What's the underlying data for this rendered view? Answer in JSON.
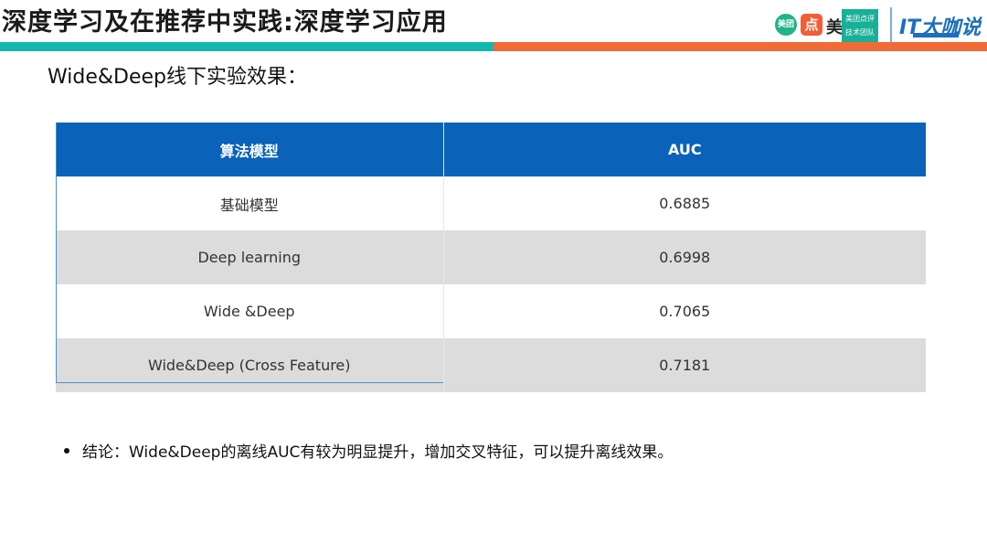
{
  "header": {
    "title": "深度学习及在推荐中实践:深度学习应用",
    "logos": {
      "meituan": "美团",
      "dianping_glyph": "点",
      "mei": "美",
      "team_line1": "美团点评",
      "team_line2": "技术团队",
      "it": "IT大咖说"
    }
  },
  "subtitle": "Wide&Deep线下实验效果：",
  "table": {
    "headers": [
      "算法模型",
      "AUC"
    ],
    "rows": [
      {
        "model": "基础模型",
        "auc": "0.6885"
      },
      {
        "model": "Deep learning",
        "auc": "0.6998"
      },
      {
        "model": "Wide &Deep",
        "auc": "0.7065"
      },
      {
        "model": "Wide&Deep (Cross Feature)",
        "auc": "0.7181"
      }
    ]
  },
  "conclusion": "结论：Wide&Deep的离线AUC有较为明显提升，增加交叉特征，可以提升离线效果。",
  "colors": {
    "header_bg": "#0a62b9",
    "row_alt": "#dcdcdc",
    "bar_teal": "#12b8ae",
    "bar_orange": "#f26b36"
  }
}
